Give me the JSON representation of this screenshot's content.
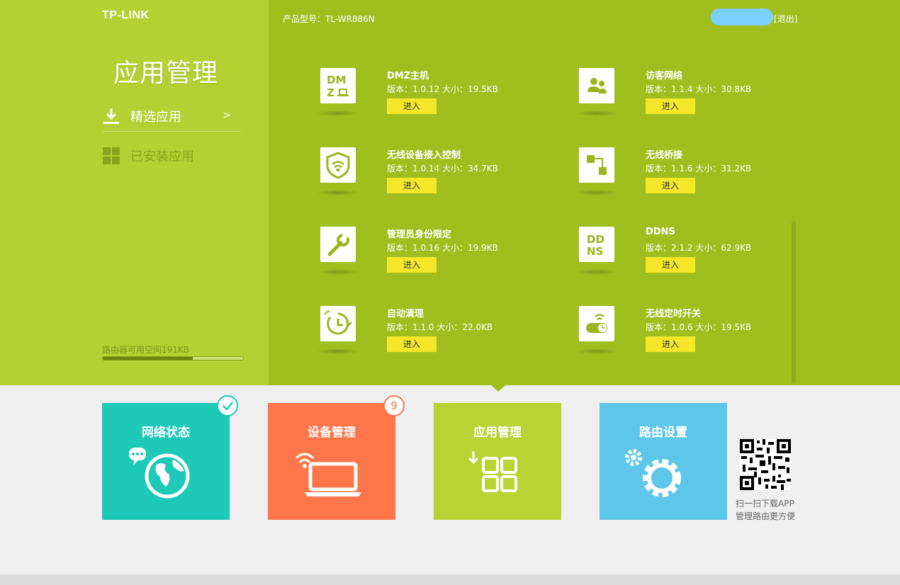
{
  "header": {
    "brand": "TP-LINK",
    "model_label": "产品型号：TL-WR886N",
    "logout": "[退出]"
  },
  "sidebar": {
    "title": "应用管理",
    "items": [
      {
        "label": "精选应用",
        "chevron": ">",
        "icon": "download-icon",
        "active": true
      },
      {
        "label": "已安装应用",
        "icon": "grid-icon",
        "active": false
      }
    ],
    "storage_label": "路由器可用空间191KB",
    "storage_used_fraction": 0.64
  },
  "apps": [
    {
      "name": "DMZ主机",
      "meta": "版本：1.0.12 大小：19.5KB",
      "enter": "进入",
      "icon": "dmz-icon"
    },
    {
      "name": "访客网络",
      "meta": "版本：1.1.4 大小：30.8KB",
      "enter": "进入",
      "icon": "guest-users-icon"
    },
    {
      "name": "无线设备接入控制",
      "meta": "版本：1.0.14 大小：34.7KB",
      "enter": "进入",
      "icon": "wifi-shield-icon"
    },
    {
      "name": "无线桥接",
      "meta": "版本：1.1.6 大小：31.2KB",
      "enter": "进入",
      "icon": "bridge-icon"
    },
    {
      "name": "管理员身份限定",
      "meta": "版本：1.0.16 大小：19.9KB",
      "enter": "进入",
      "icon": "wrench-icon"
    },
    {
      "name": "DDNS",
      "meta": "版本：2.1.2 大小：62.9KB",
      "enter": "进入",
      "icon": "ddns-icon"
    },
    {
      "name": "自动清理",
      "meta": "版本：1.1.0 大小：22.0KB",
      "enter": "进入",
      "icon": "auto-clean-icon"
    },
    {
      "name": "无线定时开关",
      "meta": "版本：1.0.6 大小：19.5KB",
      "enter": "进入",
      "icon": "wifi-timer-icon"
    }
  ],
  "tiles": [
    {
      "label": "网络状态",
      "icon": "globe-chat-icon",
      "color": "#1ec9b7"
    },
    {
      "label": "设备管理",
      "icon": "laptop-wifi-icon",
      "color": "#fe764a",
      "badge": "9"
    },
    {
      "label": "应用管理",
      "icon": "apps-grid-icon",
      "color": "#b9d234"
    },
    {
      "label": "路由设置",
      "icon": "gears-icon",
      "color": "#5ec6e8"
    }
  ],
  "qr": {
    "line1": "扫一扫下载APP",
    "line2": "管理路由更方便"
  },
  "colors": {
    "sidebar_bg": "#b4d032",
    "content_bg": "#a0be1e",
    "enter_button": "#f4e72a"
  }
}
